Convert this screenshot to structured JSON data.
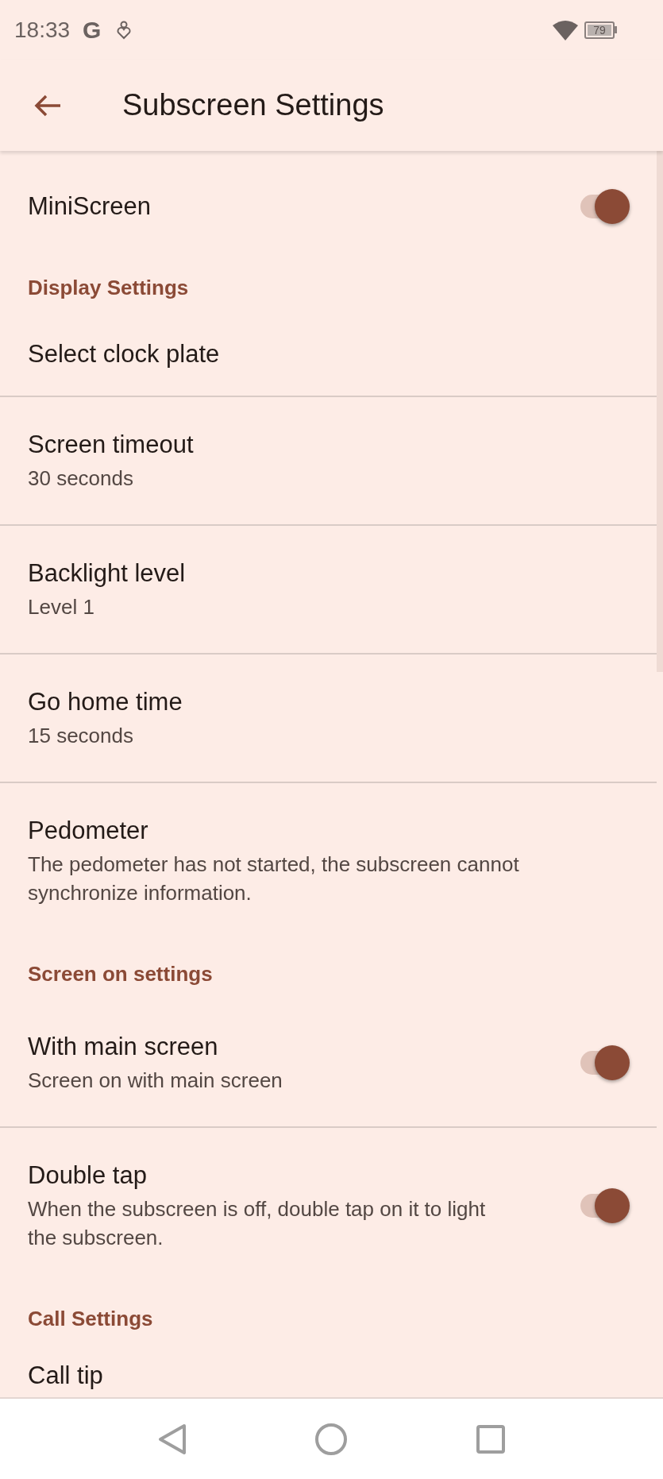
{
  "status_bar": {
    "time": "18:33",
    "g_letter": "G",
    "battery": "79"
  },
  "app_bar": {
    "title": "Subscreen Settings"
  },
  "items": [
    {
      "kind": "switch",
      "title": "MiniScreen",
      "on": true
    },
    {
      "kind": "header",
      "title": "Display Settings"
    },
    {
      "kind": "item",
      "title": "Select clock plate"
    },
    {
      "kind": "item",
      "title": "Screen timeout",
      "summary": "30 seconds"
    },
    {
      "kind": "item",
      "title": "Backlight level",
      "summary": "Level 1"
    },
    {
      "kind": "item",
      "title": "Go home time",
      "summary": "15 seconds"
    },
    {
      "kind": "item",
      "title": "Pedometer",
      "summary": "The pedometer has not started, the subscreen cannot synchronize information."
    },
    {
      "kind": "header",
      "title": "Screen on settings"
    },
    {
      "kind": "switch",
      "title": "With main screen",
      "summary": "Screen on with main screen",
      "on": true
    },
    {
      "kind": "switch",
      "title": "Double tap",
      "summary": "When the subscreen is off, double tap on it to light the subscreen.",
      "on": true
    },
    {
      "kind": "header",
      "title": "Call Settings"
    },
    {
      "kind": "item",
      "title": "Call tip"
    }
  ]
}
